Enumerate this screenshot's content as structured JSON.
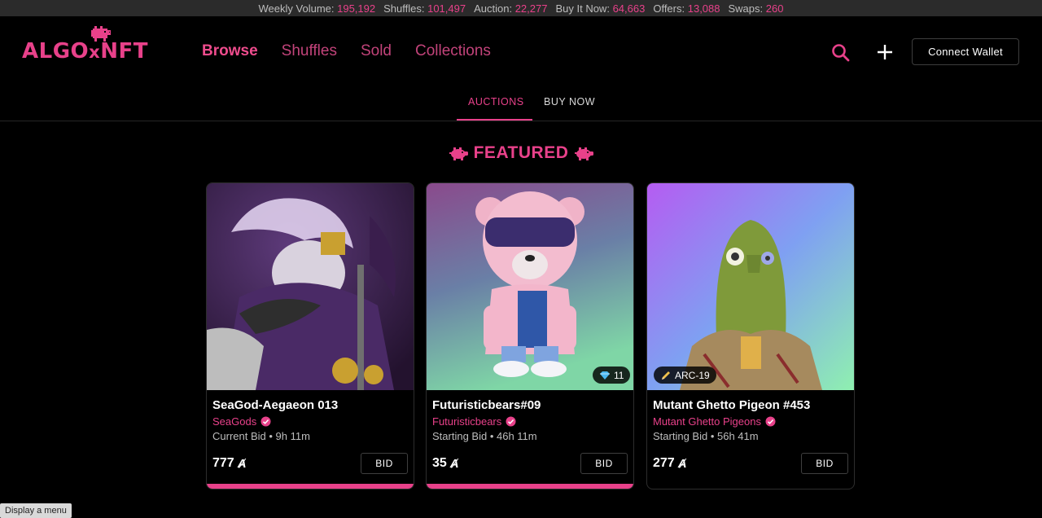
{
  "ticker": [
    {
      "label": "Weekly Volume:",
      "value": "195,192"
    },
    {
      "label": "Shuffles:",
      "value": "101,497"
    },
    {
      "label": "Auction:",
      "value": "22,277"
    },
    {
      "label": "Buy It Now:",
      "value": "64,663"
    },
    {
      "label": "Offers:",
      "value": "13,088"
    },
    {
      "label": "Swaps:",
      "value": "260"
    }
  ],
  "header": {
    "logo_text": "ALGO",
    "logo_x": "x",
    "logo_suffix": "NFT",
    "nav": [
      "Browse",
      "Shuffles",
      "Sold",
      "Collections"
    ],
    "connect_label": "Connect Wallet"
  },
  "tabs": {
    "auctions": "AUCTIONS",
    "buy_now": "BUY NOW"
  },
  "featured_title": "FEATURED",
  "cards": [
    {
      "name": "SeaGod-Aegaeon 013",
      "collection": "SeaGods",
      "meta": "Current Bid • 9h 11m",
      "price": "777",
      "bid_label": "BID",
      "badge": ""
    },
    {
      "name": "Futuristicbears#09",
      "collection": "Futuristicbears",
      "meta": "Starting Bid • 46h 11m",
      "price": "35",
      "bid_label": "BID",
      "badge": "11"
    },
    {
      "name": "Mutant Ghetto Pigeon #453",
      "collection": "Mutant Ghetto Pigeons",
      "meta": "Starting Bid • 56h 41m",
      "price": "277",
      "bid_label": "BID",
      "badge": "ARC-19"
    }
  ],
  "algo_symbol": "Ⱥ",
  "tooltip": "Display a menu",
  "colors": {
    "accent": "#e8418a",
    "ticker_bg": "#2b2b2b",
    "bg": "#000000"
  }
}
